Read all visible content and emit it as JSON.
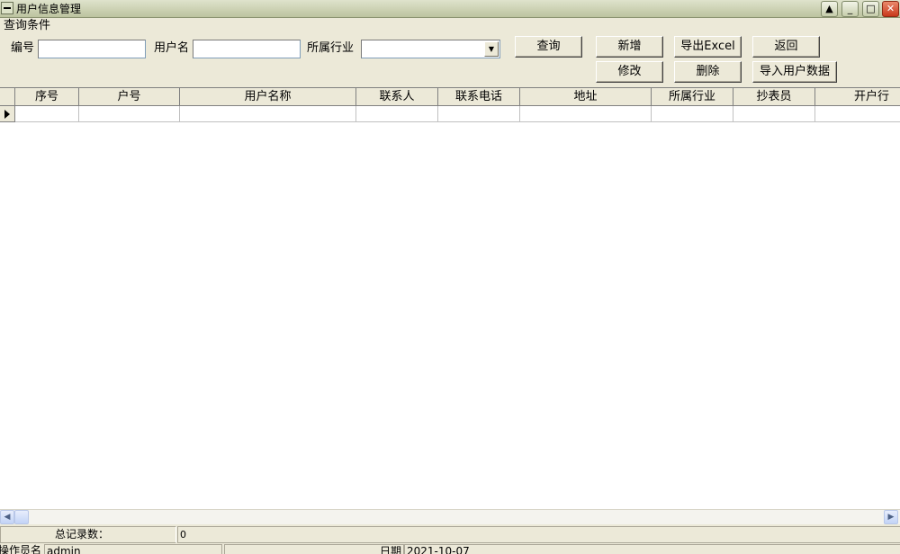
{
  "window": {
    "title": "用户信息管理",
    "buttons": {
      "help": "▲",
      "minimize": "_",
      "maximize": "□",
      "close": "✕"
    }
  },
  "query": {
    "legend": "查询条件",
    "id_label": "编号",
    "id_value": "",
    "username_label": "用户名",
    "username_value": "",
    "industry_label": "所属行业",
    "industry_value": ""
  },
  "buttons": {
    "search": "查询",
    "add": "新增",
    "export_excel": "导出Excel",
    "back": "返回",
    "edit": "修改",
    "delete": "删除",
    "import_users": "导入用户数据"
  },
  "grid": {
    "columns": [
      "序号",
      "户号",
      "用户名称",
      "联系人",
      "联系电话",
      "地址",
      "所属行业",
      "抄表员",
      "开户行"
    ]
  },
  "total": {
    "label": "总记录数：",
    "value": "0"
  },
  "status": {
    "operator_label": "操作员名",
    "operator_value": "admin",
    "date_label": "日期",
    "date_value": "2021-10-07"
  }
}
